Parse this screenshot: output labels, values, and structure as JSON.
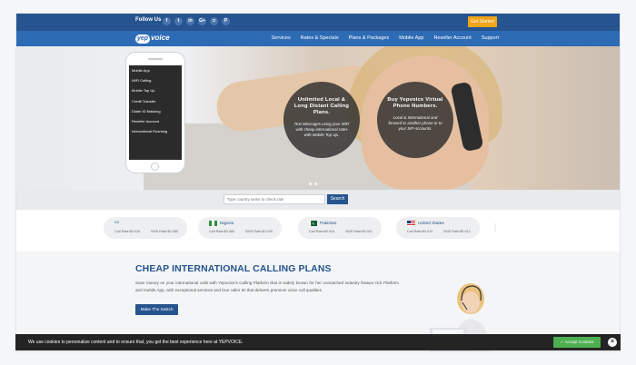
{
  "topbar": {
    "follow_label": "Follow Us",
    "social_icons": [
      "facebook-icon",
      "twitter-icon",
      "linkedin-icon",
      "google-plus-icon",
      "instagram-icon",
      "pinterest-icon"
    ],
    "social_glyphs": [
      "f",
      "t",
      "in",
      "G+",
      "◘",
      "P"
    ],
    "get_started_label": "Get Started"
  },
  "nav": {
    "logo_badge": "yep",
    "logo_text": "voice",
    "links": [
      "Services",
      "Rates & Specials",
      "Plans & Packages",
      "Mobile App",
      "Reseller Account",
      "Support"
    ]
  },
  "hero": {
    "phone_menu": [
      "Mobile App",
      "WiFi Calling",
      "Mobile Top Up",
      "Credit Transfer",
      "Dialer ID Masking",
      "Reseller Account",
      "International Roaming"
    ],
    "circle1": {
      "title": "Unlimited Local & Long Distant Calling Plans.",
      "subtitle": "Text Messages using your WiFi with cheap international rates with Mobile Top Up."
    },
    "circle2": {
      "title": "Buy Yepvoice Virtual Phone Numbers.",
      "subtitle": "Local & International and forward to another phone or to your SIP Accounts."
    }
  },
  "search": {
    "placeholder": "Type country name to check rate",
    "button_label": "Search"
  },
  "rates": [
    {
      "country": "co",
      "call_rate": "Call Rate:$0.016",
      "sms_rate": "SMS Rate:$0.080",
      "flag": [
        "#2f8f3a",
        "#ffffff",
        "#2f8f3a"
      ]
    },
    {
      "country": "Nigeria",
      "call_rate": "Call Rate:$0.089",
      "sms_rate": "SMS Rate:$0.039",
      "flag": [
        "#2f8f3a",
        "#ffffff",
        "#2f8f3a"
      ]
    },
    {
      "country": "Pakistan",
      "call_rate": "Call Rate:$0.014",
      "sms_rate": "SMS Rate:$0.001",
      "flag": [
        "#0f5a2e",
        "#0f5a2e",
        "#0f5a2e"
      ]
    },
    {
      "country": "United States",
      "call_rate": "Call Rate:$0.019",
      "sms_rate": "SMS Rate:$0.012",
      "flag": [
        "#c62828",
        "#ffffff",
        "#1e3a8a"
      ]
    }
  ],
  "content": {
    "heading": "CHEAP INTERNATIONAL CALLING PLANS",
    "paragraph": "Save money on your international calls with Yepvoice's Calling Platform that is widely known for her unmatched industry feature rich Platform and mobile App, with exceptional services and true caller ID that delivers premium voice call qualities.",
    "button_label": "Make The Switch"
  },
  "cookie": {
    "text": "We use cookies to personalize content and to ensure that, you get the best experience here at YEPVOICE.",
    "accept_label": "✓ Accept Cookies",
    "close_glyph": "×"
  },
  "colors": {
    "brand_dark_blue": "#26548f",
    "nav_blue": "#2e6bb5",
    "cta_orange": "#f0a419",
    "accept_green": "#4caf50"
  }
}
